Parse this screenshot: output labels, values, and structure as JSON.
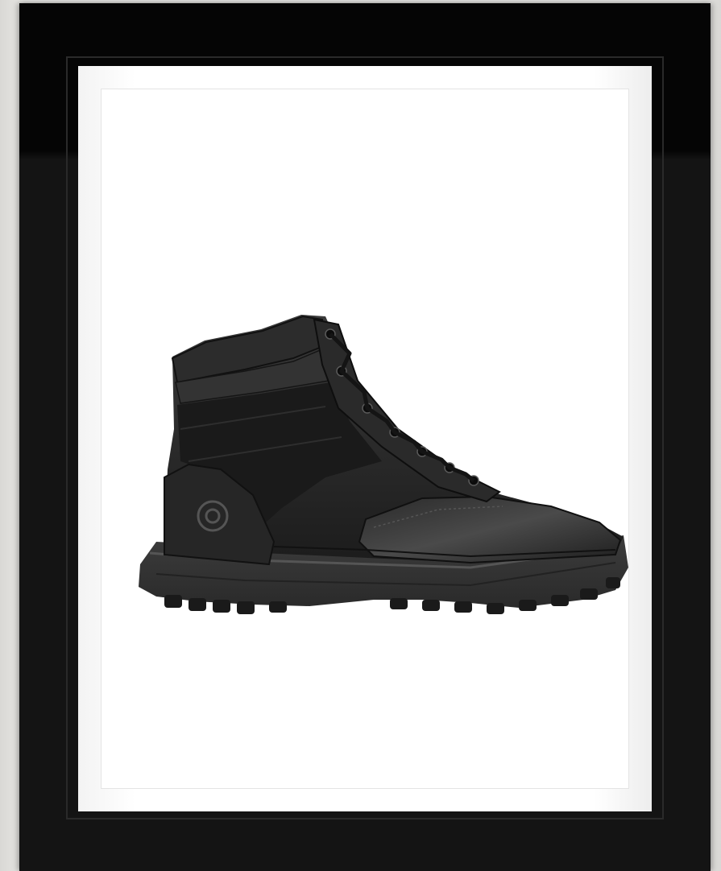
{
  "artwork": {
    "subject": "boot-photo",
    "frame_color": "#050505",
    "mat_color": "#ffffff",
    "wall_color": "#e2e1df"
  }
}
